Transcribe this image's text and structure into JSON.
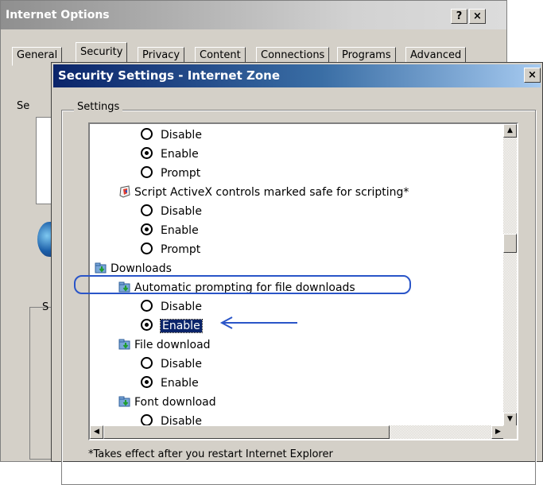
{
  "back_window": {
    "title": "Internet Options",
    "help_btn": "?",
    "close_btn": "×",
    "tabs": [
      "General",
      "Security",
      "Privacy",
      "Content",
      "Connections",
      "Programs",
      "Advanced"
    ],
    "left_text_1": "Se",
    "left_text_2": "S"
  },
  "front_window": {
    "title": "Security Settings - Internet Zone",
    "close_btn": "×",
    "group_label": "Settings",
    "items": [
      {
        "kind": "radio",
        "label": "Disable",
        "checked": false
      },
      {
        "kind": "radio",
        "label": "Enable",
        "checked": true
      },
      {
        "kind": "radio",
        "label": "Prompt",
        "checked": false
      },
      {
        "kind": "setting",
        "label": "Script ActiveX controls marked safe for scripting*",
        "icon": "activex-shield-icon"
      },
      {
        "kind": "radio",
        "label": "Disable",
        "checked": false
      },
      {
        "kind": "radio",
        "label": "Enable",
        "checked": true
      },
      {
        "kind": "radio",
        "label": "Prompt",
        "checked": false
      },
      {
        "kind": "category",
        "label": "Downloads",
        "icon": "downloads-folder-icon"
      },
      {
        "kind": "setting",
        "label": "Automatic prompting for file downloads",
        "icon": "download-setting-icon"
      },
      {
        "kind": "radio",
        "label": "Disable",
        "checked": false
      },
      {
        "kind": "radio",
        "label": "Enable",
        "checked": true,
        "selected": true
      },
      {
        "kind": "setting",
        "label": "File download",
        "icon": "download-setting-icon"
      },
      {
        "kind": "radio",
        "label": "Disable",
        "checked": false
      },
      {
        "kind": "radio",
        "label": "Enable",
        "checked": true
      },
      {
        "kind": "setting",
        "label": "Font download",
        "icon": "download-setting-icon"
      },
      {
        "kind": "radio",
        "label": "Disable",
        "checked": false
      }
    ],
    "footnote": "*Takes effect after you restart Internet Explorer"
  },
  "colors": {
    "title_active": "#0a246a",
    "face": "#d4d0c8",
    "annotation": "#2a55c8"
  }
}
